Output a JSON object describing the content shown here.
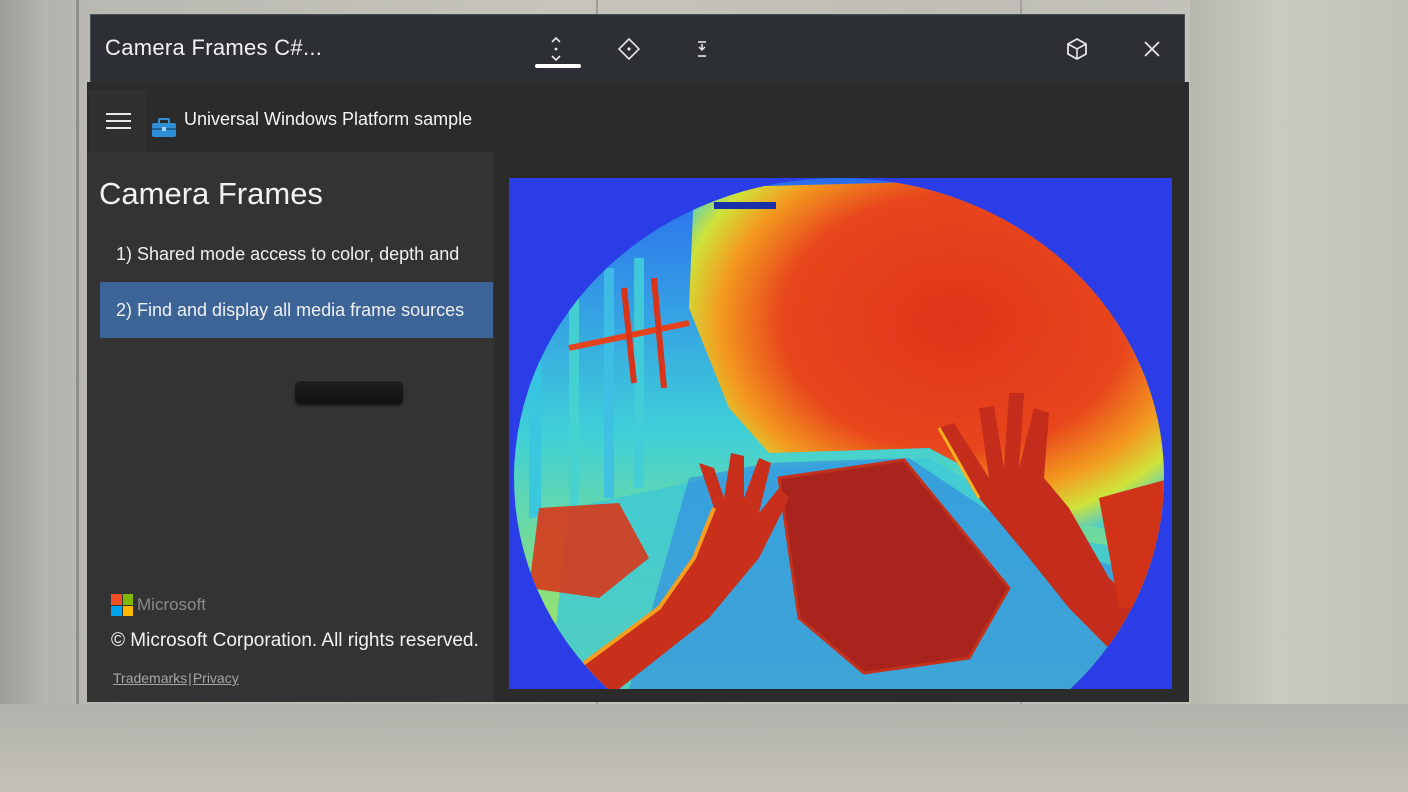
{
  "window": {
    "title": "Camera Frames C#...",
    "controls": {
      "follow_icon": "follow-icon",
      "move_icon": "move-icon",
      "resize_icon": "resize-icon",
      "hologram_icon": "hologram-icon",
      "close_icon": "close-icon"
    }
  },
  "header": {
    "menu_icon": "hamburger-icon",
    "app_icon": "toolbox-icon",
    "sample_title": "Universal Windows Platform sample"
  },
  "sidebar": {
    "title": "Camera Frames",
    "scenarios": [
      {
        "label": "1) Shared mode access to color, depth and",
        "selected": false
      },
      {
        "label": "2) Find and display all media frame sources",
        "selected": true
      }
    ],
    "footer": {
      "brand": "Microsoft",
      "copyright": "© Microsoft Corporation. All rights reserved.",
      "links": [
        "Trademarks",
        "Privacy"
      ],
      "separator": "|"
    }
  },
  "colors": {
    "titlebar_bg": "#2c3035",
    "pane_bg": "#333333",
    "selected_bg": "#3c6496",
    "frame_background": "#2a3de6",
    "ms_red": "#f25022",
    "ms_green": "#7fba00",
    "ms_blue": "#00a4ef",
    "ms_yellow": "#ffb900"
  }
}
